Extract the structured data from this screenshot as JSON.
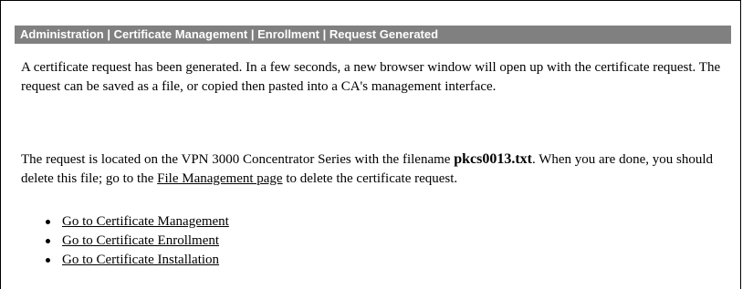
{
  "header": {
    "breadcrumb_title": "Administration | Certificate Management | Enrollment | Request Generated"
  },
  "content": {
    "intro_text": "A certificate request has been generated. In a few seconds, a new browser window will open up with the certificate request. The request can be saved as a file, or copied then pasted into a CA's management interface.",
    "location_prefix": "The request is located on the VPN 3000 Concentrator Series with the filename",
    "filename": "pkcs0013.txt",
    "location_middle": ". When you are done, you should delete this file; go to the",
    "file_management_link": "File Management page",
    "location_suffix": "to delete the certificate request."
  },
  "links": {
    "certificate_management": "Go to Certificate Management",
    "certificate_enrollment": "Go to Certificate Enrollment",
    "certificate_installation": "Go to Certificate Installation"
  },
  "colors": {
    "title_bar_background": "#808080",
    "title_bar_text": "#ffffff",
    "body_text": "#000000",
    "page_background": "#ffffff"
  },
  "icons": {
    "list_bullet": "bullet-icon"
  }
}
